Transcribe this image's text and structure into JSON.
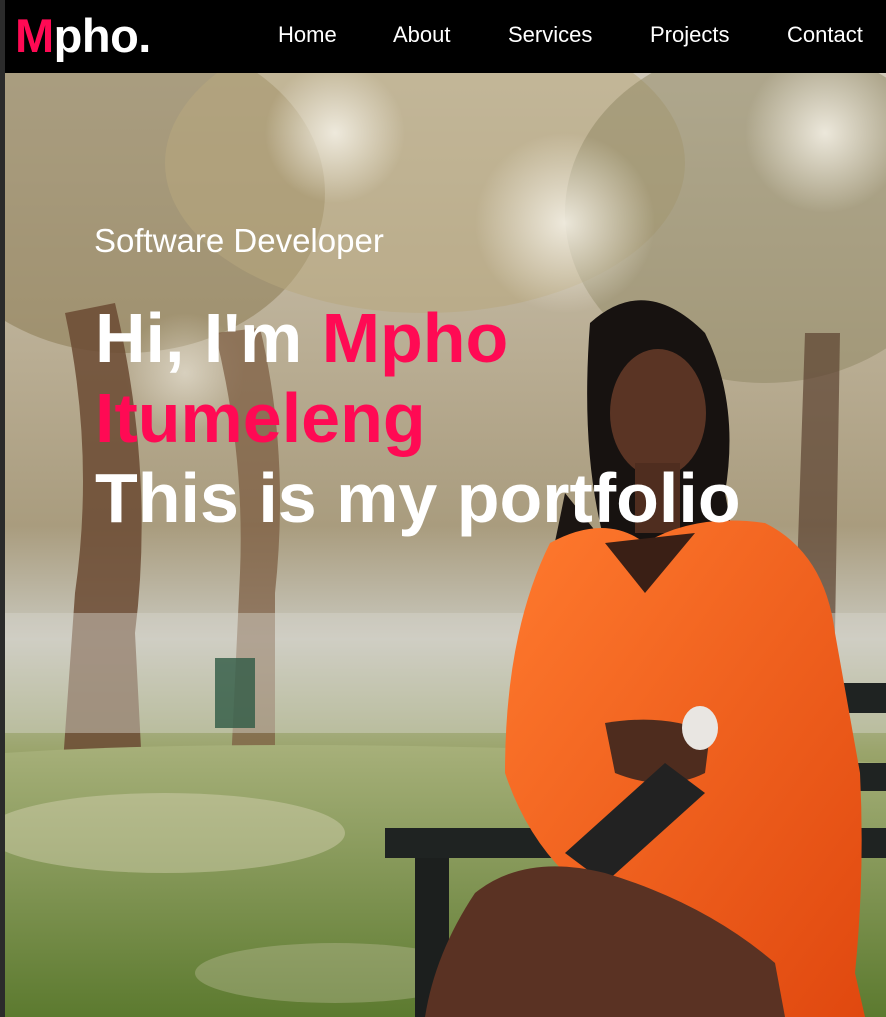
{
  "logo": {
    "accent_letter": "M",
    "rest": "pho."
  },
  "nav": {
    "items": [
      {
        "label": "Home"
      },
      {
        "label": "About"
      },
      {
        "label": "Services"
      },
      {
        "label": "Projects"
      },
      {
        "label": "Contact"
      }
    ]
  },
  "hero": {
    "subtitle": "Software Developer",
    "greeting": "Hi, I'm ",
    "first_name": "Mpho",
    "last_name": "Itumeleng",
    "tagline": "This is my portfolio"
  },
  "colors": {
    "accent": "#ff0a54",
    "navbar": "#000000",
    "text": "#ffffff",
    "jacket": "#f25a1a"
  }
}
